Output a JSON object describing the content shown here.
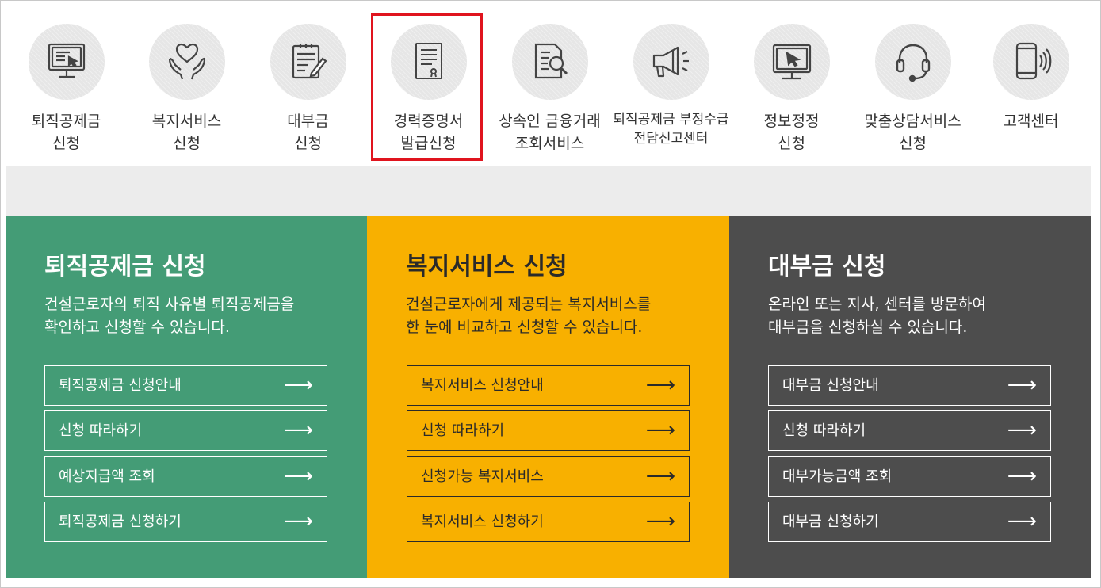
{
  "quick_menu": [
    {
      "l1": "퇴직공제금",
      "l2": "신청",
      "icon": "monitor-cursor-icon"
    },
    {
      "l1": "복지서비스",
      "l2": "신청",
      "icon": "heart-hands-icon"
    },
    {
      "l1": "대부금",
      "l2": "신청",
      "icon": "document-pencil-icon"
    },
    {
      "l1": "경력증명서",
      "l2": "발급신청",
      "icon": "certificate-icon"
    },
    {
      "l1": "상속인 금융거래",
      "l2": "조회서비스",
      "icon": "document-search-icon"
    },
    {
      "l1": "퇴직공제금 부정수급",
      "l2": "전담신고센터",
      "icon": "megaphone-icon"
    },
    {
      "l1": "정보정정",
      "l2": "신청",
      "icon": "monitor-edit-icon"
    },
    {
      "l1": "맞춤상담서비스",
      "l2": "신청",
      "icon": "headset-icon"
    },
    {
      "l1": "고객센터",
      "l2": "",
      "icon": "phone-call-icon"
    }
  ],
  "highlighted_item": "경력증명서 발급신청",
  "panels": [
    {
      "title": "퇴직공제금 신청",
      "desc1": "건설근로자의 퇴직 사유별 퇴직공제금을",
      "desc2": "확인하고 신청할 수 있습니다.",
      "color": "#449c76",
      "links": [
        "퇴직공제금 신청안내",
        "신청 따라하기",
        "예상지급액 조회",
        "퇴직공제금 신청하기"
      ]
    },
    {
      "title": "복지서비스 신청",
      "desc1": "건설근로자에게 제공되는 복지서비스를",
      "desc2": "한 눈에 비교하고 신청할 수 있습니다.",
      "color": "#f8b000",
      "links": [
        "복지서비스 신청안내",
        "신청 따라하기",
        "신청가능 복지서비스",
        "복지서비스 신청하기"
      ]
    },
    {
      "title": "대부금 신청",
      "desc1": "온라인 또는 지사, 센터를 방문하여",
      "desc2": "대부금을 신청하실 수 있습니다.",
      "color": "#4d4d4d",
      "links": [
        "대부금 신청안내",
        "신청 따라하기",
        "대부가능금액 조회",
        "대부금 신청하기"
      ]
    }
  ],
  "arrow": "⟶"
}
